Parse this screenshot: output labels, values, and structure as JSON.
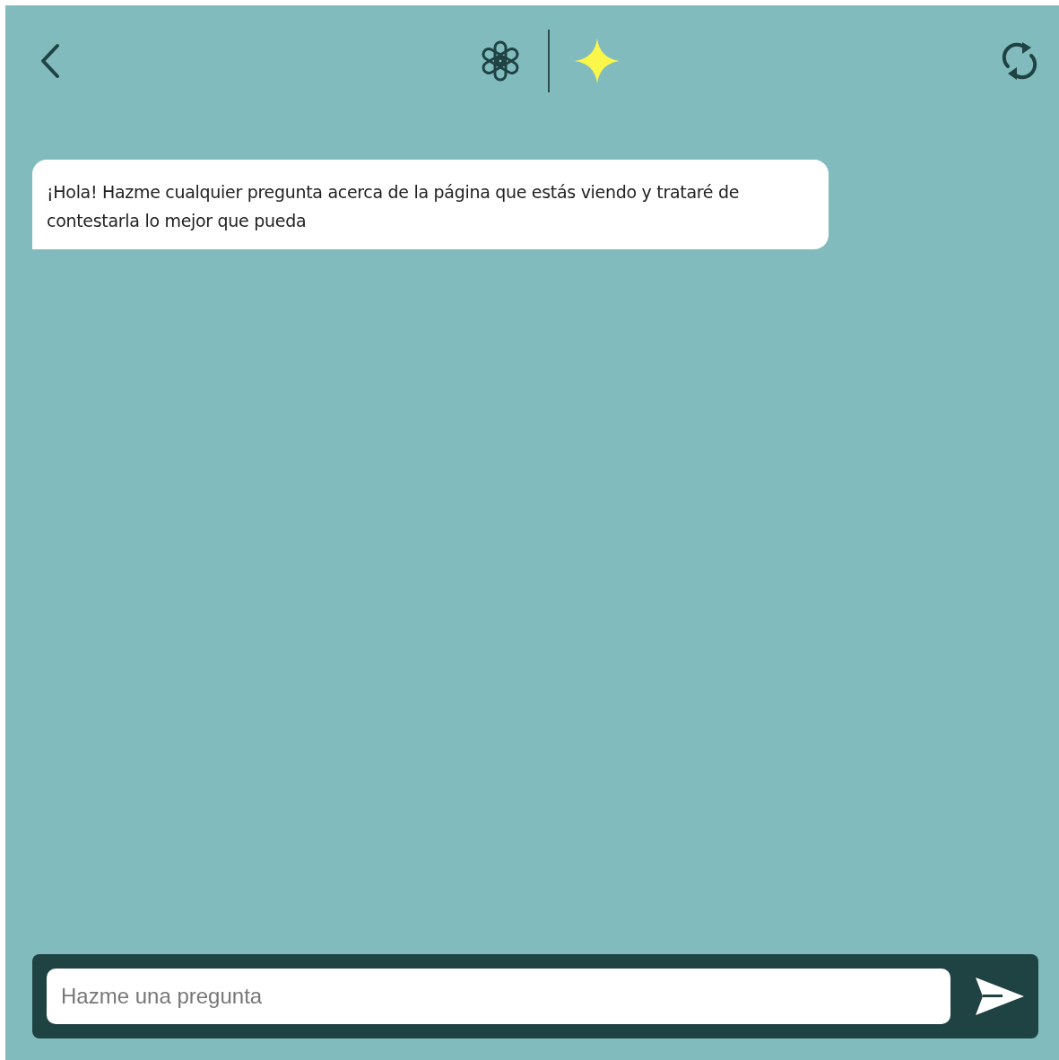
{
  "messages": [
    {
      "text": "¡Hola! Hazme cualquier pregunta acerca de la página que estás viendo y trataré de contestarla lo mejor que pueda"
    }
  ],
  "composer": {
    "placeholder": "Hazme una pregunta"
  }
}
